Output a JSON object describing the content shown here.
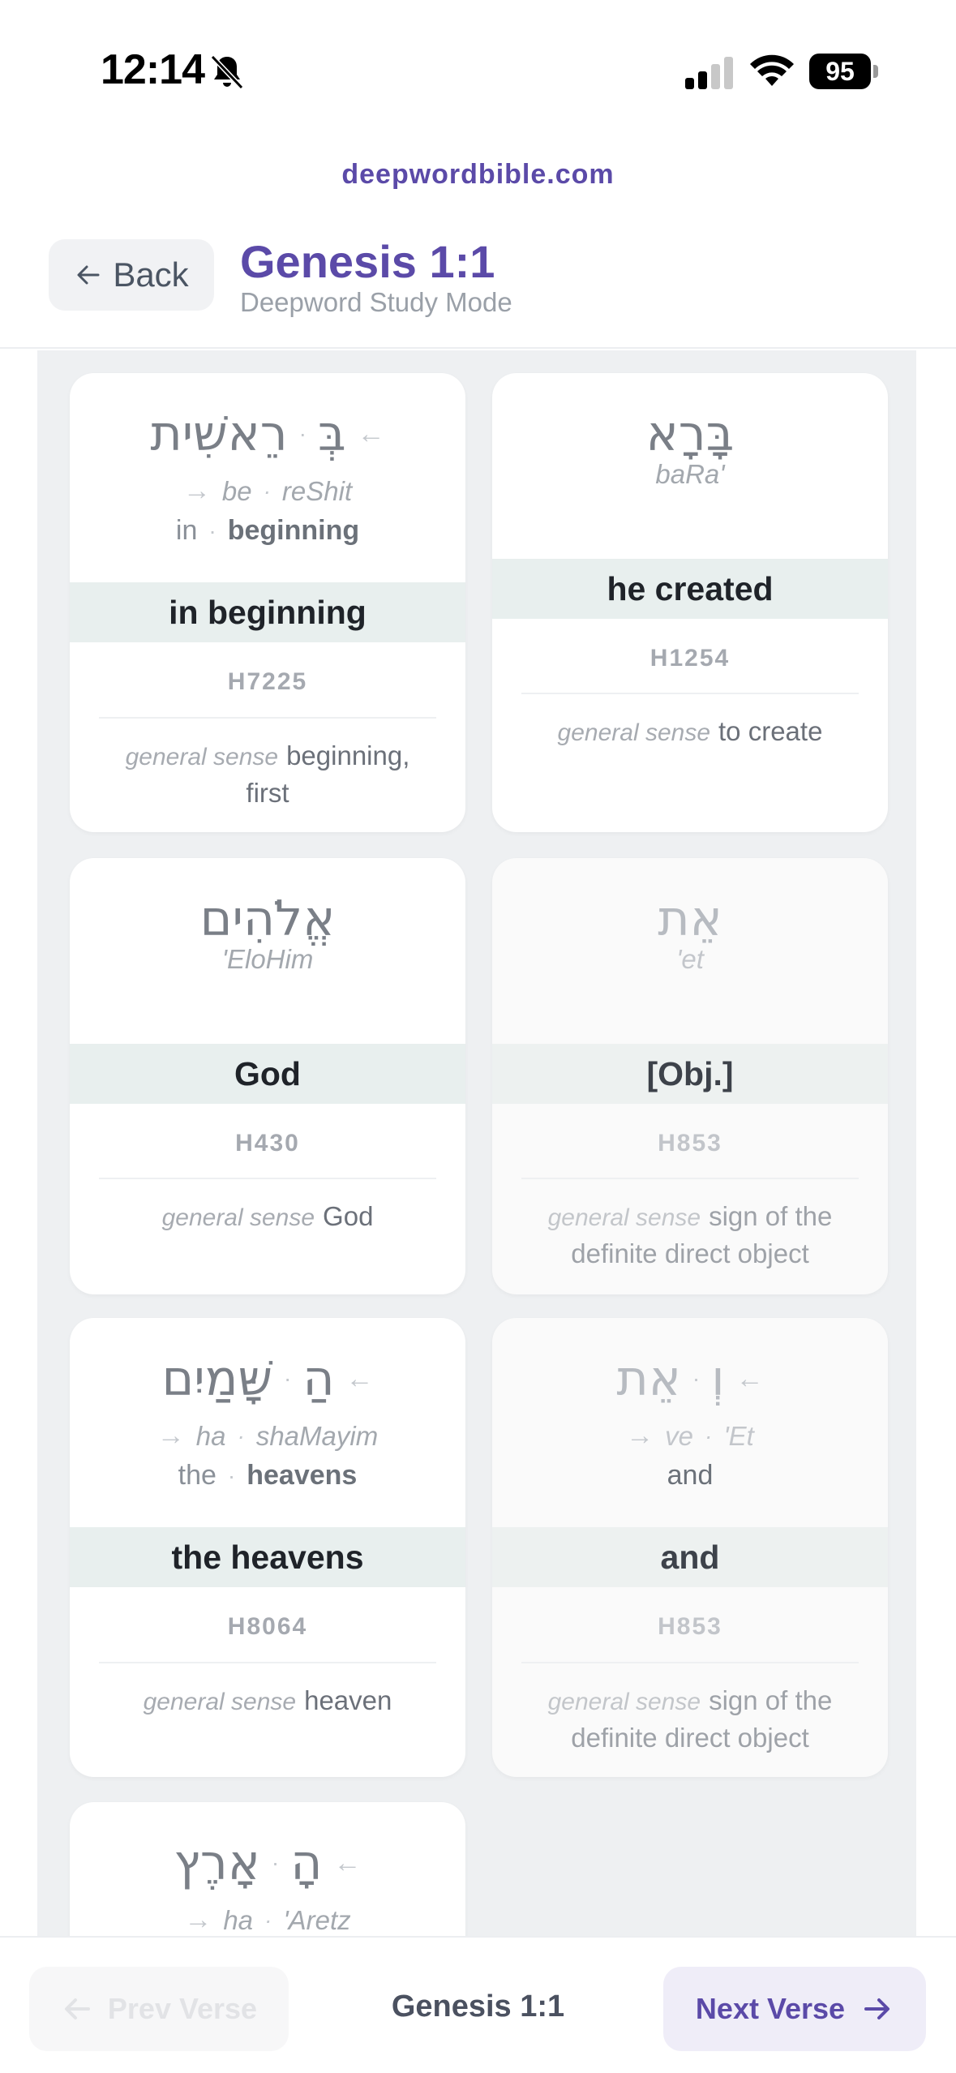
{
  "status": {
    "time": "12:14",
    "battery": "95"
  },
  "site": "deepwordbible.com",
  "header": {
    "back_label": "Back",
    "title": "Genesis 1:1",
    "subtitle": "Deepword Study Mode"
  },
  "cards": [
    {
      "hebrew_main": "רֵאשִׁית",
      "hebrew_prefix": "בְּ",
      "translit_prefix": "be",
      "translit_main": "reShit",
      "gloss_prefix": "in",
      "gloss_main": "beginning",
      "translation": "in beginning",
      "strongs": "H7225",
      "sense_label": "general sense",
      "sense": "beginning, first"
    },
    {
      "hebrew_main": "בָּרָא",
      "translit_main": "baRa'",
      "translation": "he created",
      "strongs": "H1254",
      "sense_label": "general sense",
      "sense": "to create"
    },
    {
      "hebrew_main": "אֱלֹהִים",
      "translit_main": "'EloHim",
      "translation": "God",
      "strongs": "H430",
      "sense_label": "general sense",
      "sense": "God"
    },
    {
      "hebrew_main": "אֵת",
      "translit_main": "'et",
      "translation": "[Obj.]",
      "strongs": "H853",
      "sense_label": "general sense",
      "sense": "sign of the definite direct object"
    },
    {
      "hebrew_main": "שָּׁמַיִם",
      "hebrew_prefix": "הַ",
      "translit_prefix": "ha",
      "translit_main": "shaMayim",
      "gloss_prefix": "the",
      "gloss_main": "heavens",
      "translation": "the heavens",
      "strongs": "H8064",
      "sense_label": "general sense",
      "sense": "heaven"
    },
    {
      "hebrew_main": "אֵת",
      "hebrew_prefix": "וְ",
      "translit_prefix": "ve",
      "translit_main": "'Et",
      "gloss_prefix": "",
      "gloss_main": "and",
      "translation": "and",
      "strongs": "H853",
      "sense_label": "general sense",
      "sense": "sign of the definite direct object"
    },
    {
      "hebrew_main": "אָרֶץ",
      "hebrew_prefix": "הָ",
      "translit_prefix": "ha",
      "translit_main": "'Aretz"
    }
  ],
  "footer": {
    "prev_label": "Prev Verse",
    "current": "Genesis 1:1",
    "next_label": "Next Verse"
  }
}
